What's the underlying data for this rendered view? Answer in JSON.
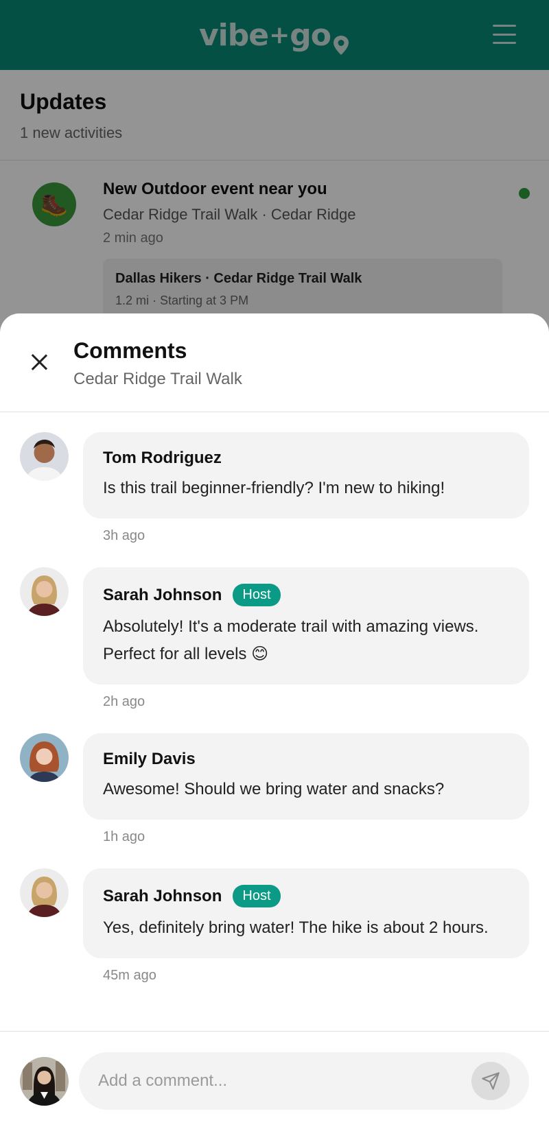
{
  "brand": {
    "name_left": "vibe",
    "plus": "+",
    "name_right": "go"
  },
  "updates": {
    "title": "Updates",
    "subtitle": "1 new activities",
    "notification": {
      "title": "New Outdoor event near you",
      "meta": "Cedar Ridge Trail Walk · Cedar Ridge",
      "time": "2 min ago",
      "icon": "hiking-boot-icon",
      "card_title": "Dallas Hikers · Cedar Ridge Trail Walk",
      "card_sub": "1.2 mi · Starting at 3 PM"
    }
  },
  "sheet": {
    "title": "Comments",
    "subtitle": "Cedar Ridge Trail Walk"
  },
  "comments": [
    {
      "name": "Tom Rodriguez",
      "badge": "",
      "text": "Is this trail beginner-friendly? I'm new to hiking!",
      "time": "3h ago"
    },
    {
      "name": "Sarah Johnson",
      "badge": "Host",
      "text": "Absolutely! It's a moderate trail with amazing views. Perfect for all levels 😊",
      "time": "2h ago"
    },
    {
      "name": "Emily Davis",
      "badge": "",
      "text": "Awesome! Should we bring water and snacks?",
      "time": "1h ago"
    },
    {
      "name": "Sarah Johnson",
      "badge": "Host",
      "text": "Yes, definitely bring water! The hike is about 2 hours.",
      "time": "45m ago"
    }
  ],
  "composer": {
    "placeholder": "Add a comment..."
  },
  "colors": {
    "brand": "#0a8a78",
    "host_badge": "#0a9a85",
    "online_dot": "#2e9e3e"
  }
}
